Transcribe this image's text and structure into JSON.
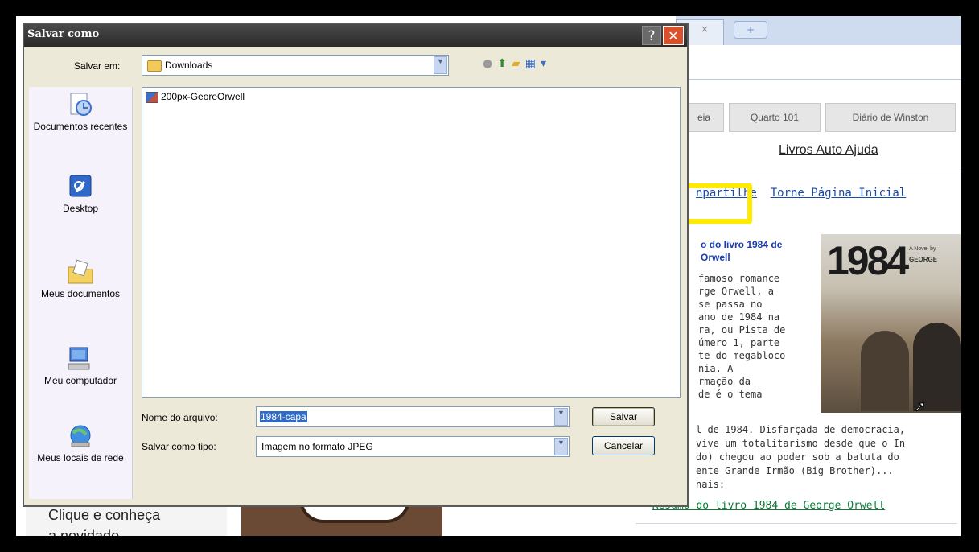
{
  "browser": {
    "tab_close": "×",
    "new_tab": "+",
    "page_tabs": [
      "eia",
      "Quarto 101",
      "Diário de Winston"
    ],
    "livros_link": "Livros Auto Ajuda",
    "links_row": [
      "npartilhe",
      "Torne Página Inicial"
    ],
    "article_title_lines": [
      "o do livro 1984 de",
      "Orwell"
    ],
    "article_lines": [
      " famoso romance",
      "rge Orwell, a",
      " se passa no",
      " ano de 1984 na",
      "ra, ou Pista de",
      "úmero 1, parte",
      "te do megabloco",
      "nia. A",
      "rmação da",
      "de é o tema"
    ],
    "article_wide_lines": [
      "l de 1984. Disfarçada de democracia, ",
      " vive um totalitarismo desde que o In",
      "do) chegou ao poder sob a batuta do",
      "ente Grande Irmão (Big Brother)...",
      "nais:"
    ],
    "resumo_prefix": "• ",
    "resumo_link": "Resumo do livro 1984 de George Orwell",
    "cover_number": "1984",
    "cover_sub": [
      "A Novel by"
    ],
    "cover_author": "GEORGE",
    "clique_lines": [
      "Clique e conheça",
      "a novidade"
    ]
  },
  "dialog": {
    "title": "Salvar como",
    "help_label": "?",
    "close_label": "✕",
    "save_in_label": "Salvar em:",
    "save_in_value": "Downloads",
    "places": [
      {
        "label": "Documentos recentes",
        "icon": "recent-documents-icon"
      },
      {
        "label": "Desktop",
        "icon": "desktop-icon"
      },
      {
        "label": "Meus documentos",
        "icon": "my-documents-icon"
      },
      {
        "label": "Meu computador",
        "icon": "my-computer-icon"
      },
      {
        "label": "Meus locais de rede",
        "icon": "network-places-icon"
      }
    ],
    "files": [
      {
        "name": "200px-GeoreOrwell",
        "icon": "image-file-icon"
      }
    ],
    "filename_label": "Nome do arquivo:",
    "filename_value": "1984-capa",
    "filetype_label": "Salvar como tipo:",
    "filetype_value": "Imagem no formato JPEG",
    "save_button": "Salvar",
    "cancel_button": "Cancelar"
  },
  "colors": {
    "annotation_arrow": "#ffeb00",
    "close_button": "#d8512c",
    "link_blue": "#1a4aa8",
    "link_green": "#0a7a3a"
  }
}
